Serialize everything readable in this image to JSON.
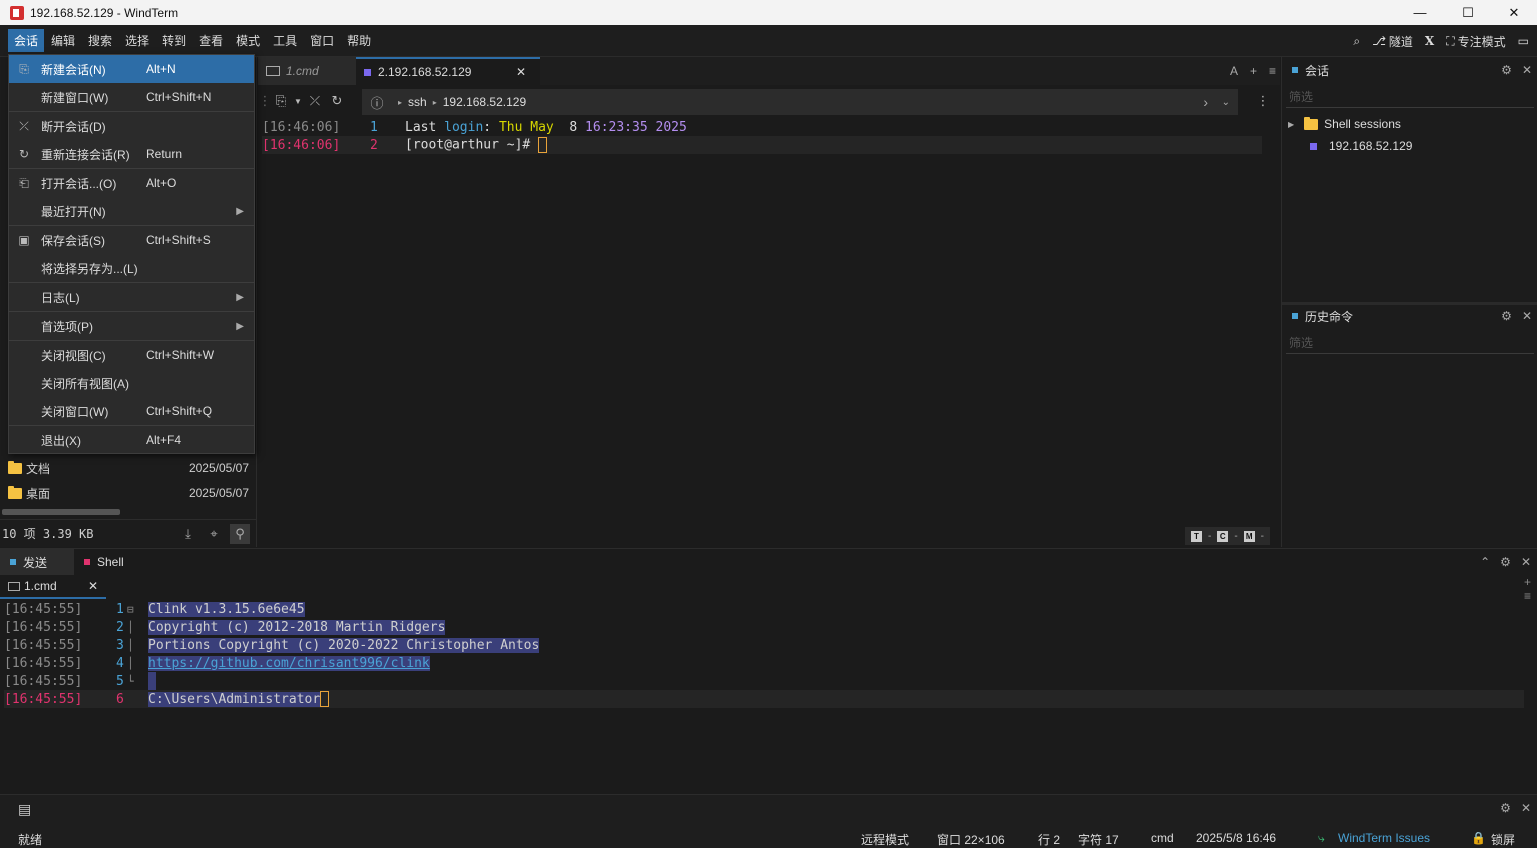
{
  "window": {
    "title": "192.168.52.129 - WindTerm",
    "minimize": "—",
    "maximize": "☐",
    "close": "✕"
  },
  "menubar": {
    "items": [
      "会话",
      "编辑",
      "搜索",
      "选择",
      "转到",
      "查看",
      "模式",
      "工具",
      "窗口",
      "帮助"
    ],
    "right": {
      "tunnel": "隧道",
      "x": "X",
      "focus": "专注模式"
    }
  },
  "dropdown": {
    "items": [
      {
        "label": "新建会话(N)",
        "shortcut": "Alt+N"
      },
      {
        "label": "新建窗口(W)",
        "shortcut": "Ctrl+Shift+N"
      },
      {
        "label": "断开会话(D)",
        "shortcut": ""
      },
      {
        "label": "重新连接会话(R)",
        "shortcut": "Return"
      },
      {
        "label": "打开会话...(O)",
        "shortcut": "Alt+O"
      },
      {
        "label": "最近打开(N)",
        "shortcut": ""
      },
      {
        "label": "保存会话(S)",
        "shortcut": "Ctrl+Shift+S"
      },
      {
        "label": "将选择另存为...(L)",
        "shortcut": ""
      },
      {
        "label": "日志(L)",
        "shortcut": ""
      },
      {
        "label": "首选项(P)",
        "shortcut": ""
      },
      {
        "label": "关闭视图(C)",
        "shortcut": "Ctrl+Shift+W"
      },
      {
        "label": "关闭所有视图(A)",
        "shortcut": ""
      },
      {
        "label": "关闭窗口(W)",
        "shortcut": "Ctrl+Shift+Q"
      },
      {
        "label": "退出(X)",
        "shortcut": "Alt+F4"
      }
    ]
  },
  "leftpane": {
    "files": [
      {
        "name": "文档",
        "date": "2025/05/07"
      },
      {
        "name": "桌面",
        "date": "2025/05/07"
      }
    ],
    "status": "10 项 3.39 KB"
  },
  "center": {
    "tabs": [
      {
        "label": "1.cmd"
      },
      {
        "label": "2.192.168.52.129"
      }
    ],
    "tab_close": "✕",
    "address": {
      "proto": "ssh",
      "host": "192.168.52.129"
    },
    "lines": [
      {
        "ts": "[16:46:06]",
        "n": "1",
        "parts": [
          [
            "Last ",
            "#dcdcdc"
          ],
          [
            "login",
            "#4aa3d6"
          ],
          [
            ": ",
            "#dcdcdc"
          ],
          [
            "Thu May",
            "#d7d700"
          ],
          [
            "  8 ",
            "#dcdcdc"
          ],
          [
            "16:23:35 2025",
            "#b48ef0"
          ]
        ]
      },
      {
        "ts": "[16:46:06]",
        "n": "2",
        "parts": [
          [
            "[root@arthur ~]# ",
            "#dcdcdc"
          ]
        ]
      }
    ],
    "keys": {
      "t": "T",
      "c": "C",
      "m": "M"
    }
  },
  "right": {
    "sessions_title": "会话",
    "filter_placeholder": "筛选",
    "tree": {
      "group": "Shell sessions",
      "item": "192.168.52.129"
    },
    "history_title": "历史命令"
  },
  "bottom": {
    "tabs": [
      "发送",
      "Shell"
    ],
    "subtab": "1.cmd",
    "lines": [
      {
        "ts": "[16:45:55]",
        "n": "1",
        "text": "Clink v1.3.15.6e6e45"
      },
      {
        "ts": "[16:45:55]",
        "n": "2",
        "text": "Copyright (c) 2012-2018 Martin Ridgers"
      },
      {
        "ts": "[16:45:55]",
        "n": "3",
        "text": "Portions Copyright (c) 2020-2022 Christopher Antos"
      },
      {
        "ts": "[16:45:55]",
        "n": "4",
        "text": "https://github.com/chrisant996/clink"
      },
      {
        "ts": "[16:45:55]",
        "n": "5",
        "text": ""
      },
      {
        "ts": "[16:45:55]",
        "n": "6",
        "text": "C:\\Users\\Administrator"
      }
    ]
  },
  "statusbar": {
    "ready": "就绪",
    "remote_mode": "远程模式",
    "window_size": "窗口 22×106",
    "row": "行 2",
    "col": "字符 17",
    "shell": "cmd",
    "datetime": "2025/5/8 16:46",
    "issues": "WindTerm Issues",
    "lock": "锁屏"
  }
}
